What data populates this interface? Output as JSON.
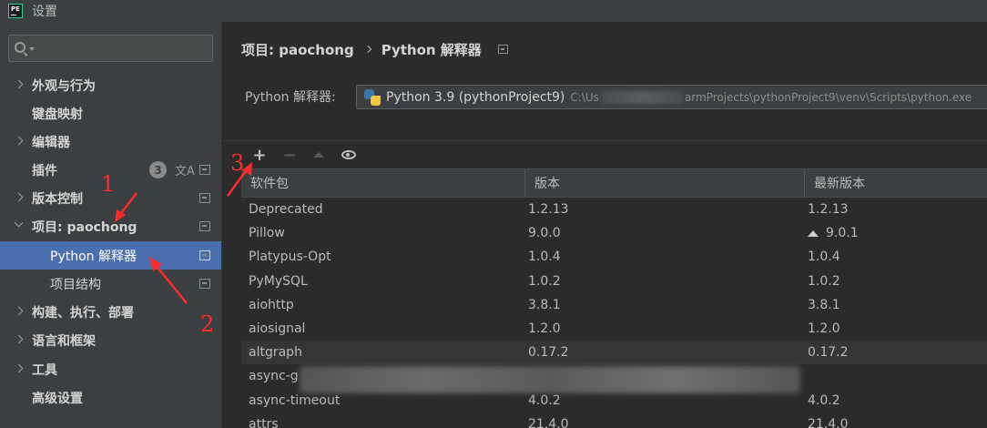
{
  "window": {
    "title": "设置",
    "app_icon_text": "PE"
  },
  "sidebar": {
    "search_placeholder": "",
    "items": [
      {
        "label": "外观与行为",
        "expandable": true
      },
      {
        "label": "键盘映射",
        "expandable": false
      },
      {
        "label": "编辑器",
        "expandable": true
      },
      {
        "label": "插件",
        "expandable": false,
        "badge": "3"
      },
      {
        "label": "版本控制",
        "expandable": true
      },
      {
        "label": "项目: paochong",
        "expandable": true,
        "expanded": true
      },
      {
        "label": "Python 解释器",
        "selected": true
      },
      {
        "label": "项目结构"
      },
      {
        "label": "构建、执行、部署",
        "expandable": true
      },
      {
        "label": "语言和框架",
        "expandable": true
      },
      {
        "label": "工具",
        "expandable": true
      },
      {
        "label": "高级设置",
        "expandable": false
      }
    ]
  },
  "breadcrumb": {
    "project": "项目: paochong",
    "page": "Python 解释器"
  },
  "interpreter": {
    "label": "Python 解释器:",
    "name": "Python 3.9 (pythonProject9)",
    "path_prefix": "C:\\Us",
    "path_suffix": "armProjects\\pythonProject9\\venv\\Scripts\\python.exe"
  },
  "toolbar": {
    "add": "+",
    "remove": "−"
  },
  "table": {
    "headers": [
      "软件包",
      "版本",
      "最新版本"
    ],
    "rows": [
      {
        "package": "Deprecated",
        "version": "1.2.13",
        "latest": "1.2.13",
        "upgrade": false
      },
      {
        "package": "Pillow",
        "version": "9.0.0",
        "latest": "9.0.1",
        "upgrade": true
      },
      {
        "package": "Platypus-Opt",
        "version": "1.0.4",
        "latest": "1.0.4",
        "upgrade": false
      },
      {
        "package": "PyMySQL",
        "version": "1.0.2",
        "latest": "1.0.2",
        "upgrade": false
      },
      {
        "package": "aiohttp",
        "version": "3.8.1",
        "latest": "3.8.1",
        "upgrade": false
      },
      {
        "package": "aiosignal",
        "version": "1.2.0",
        "latest": "1.2.0",
        "upgrade": false
      },
      {
        "package": "altgraph",
        "version": "0.17.2",
        "latest": "0.17.2",
        "upgrade": false,
        "highlight": true
      },
      {
        "package": "async-g",
        "version": "",
        "latest": "",
        "upgrade": false
      },
      {
        "package": "async-timeout",
        "version": "4.0.2",
        "latest": "4.0.2",
        "upgrade": false
      },
      {
        "package": "attrs",
        "version": "21.4.0",
        "latest": "21.4.0",
        "upgrade": false
      }
    ]
  },
  "annotations": [
    "1",
    "2",
    "3"
  ],
  "colors": {
    "selected": "#4b6eaf",
    "annotation": "#ff2a2a",
    "sidebar_bg": "#3c3f41",
    "main_bg": "#2b2b2b"
  }
}
